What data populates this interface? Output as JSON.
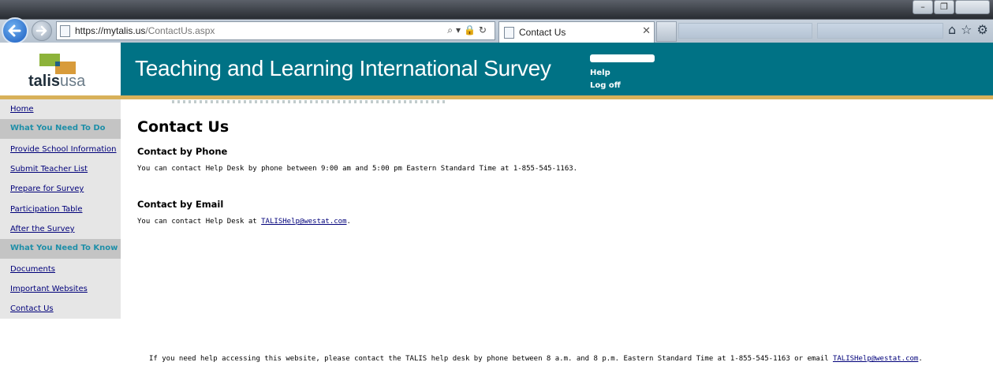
{
  "browser": {
    "url_host": "https://mytalis.us",
    "url_path": "/ContactUs.aspx",
    "tab_title": "Contact Us",
    "tab_close": "✕",
    "address_tools": "⌕▾🔒↻",
    "toolbar_icons": "⌂☆⚙",
    "window_buttons": [
      "–",
      "❐",
      ""
    ]
  },
  "header": {
    "logo_part1": "talis",
    "logo_part2": "usa",
    "site_title": "Teaching and Learning International Survey",
    "help_link": "Help",
    "logoff_link": "Log off"
  },
  "sidebar": {
    "home": "Home",
    "section1_title": "What You Need To Do",
    "section1_items": [
      "Provide School Information",
      "Submit Teacher List",
      "Prepare for Survey",
      "Participation Table",
      "After the Survey"
    ],
    "section2_title": "What You Need To Know",
    "section2_items": [
      "Documents",
      "Important Websites",
      "Contact Us"
    ]
  },
  "main": {
    "page_title": "Contact Us",
    "phone_heading": "Contact by Phone",
    "phone_text": "You can contact Help Desk by phone between 9:00 am and 5:00 pm Eastern Standard Time at 1-855-545-1163.",
    "email_heading": "Contact by Email",
    "email_text_prefix": "You can contact Help Desk at ",
    "email_link": "TALISHelp@westat.com",
    "email_text_suffix": "."
  },
  "footer": {
    "text_prefix": "If you need help accessing this website, please contact the TALIS help desk by phone between 8 a.m. and 8 p.m. Eastern Standard Time at 1-855-545-1163 or email ",
    "email_link": "TALISHelp@westat.com",
    "text_suffix": "."
  },
  "colors": {
    "header_teal": "#007285",
    "gold_bar": "#d8b15a",
    "sidebar_bg": "#e6e6e6",
    "sidebar_heading_bg": "#c4c4c4",
    "sidebar_heading_text": "#1f8fa8",
    "link": "#00007a"
  }
}
